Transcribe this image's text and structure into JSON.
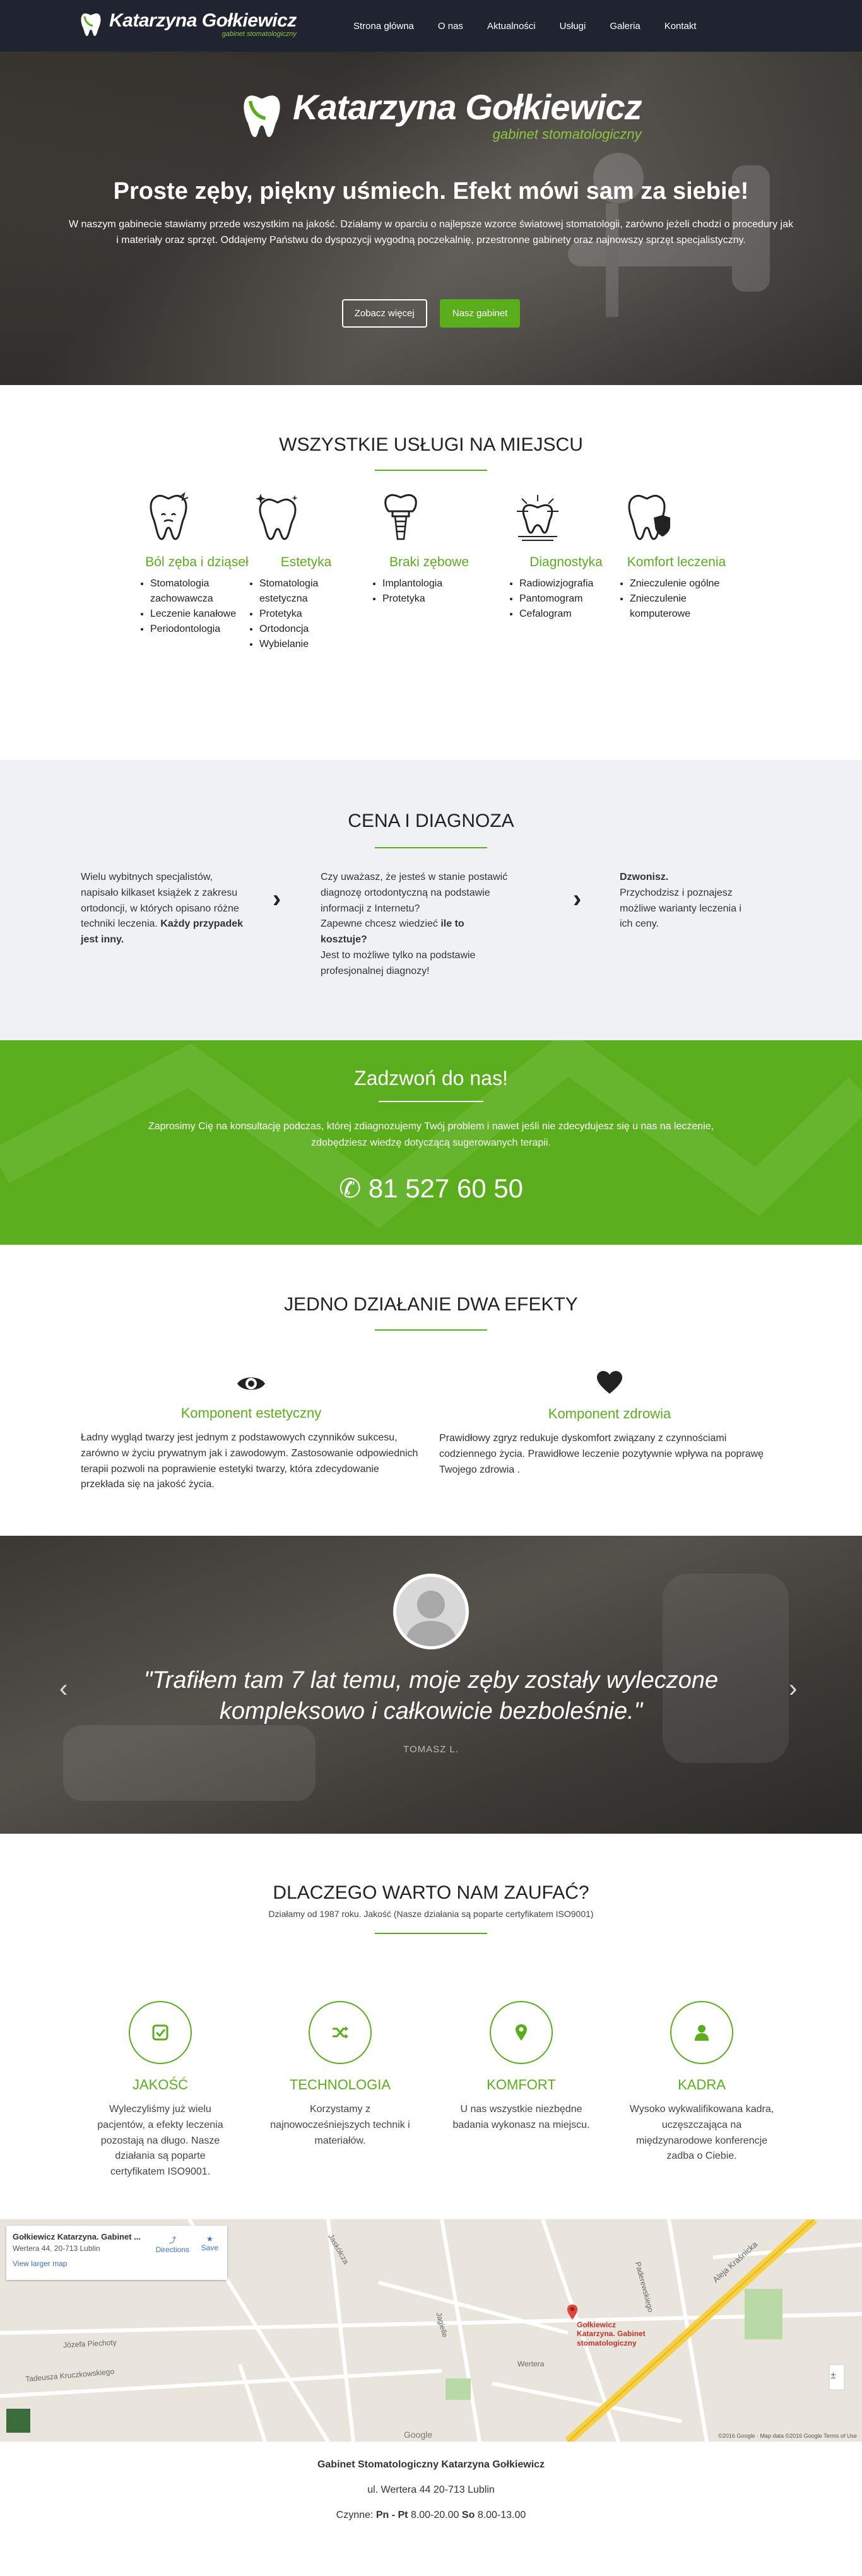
{
  "nav": {
    "logo_first": "Katarzyna",
    "logo_last": "Gołkiewicz",
    "logo_sub": "gabinet stomatologiczny",
    "items": [
      "Strona główna",
      "O nas",
      "Aktualności",
      "Usługi",
      "Galeria",
      "Kontakt"
    ]
  },
  "hero": {
    "logo_first": "Katarzyna",
    "logo_last": "Gołkiewicz",
    "logo_sub": "gabinet stomatologiczny",
    "title": "Proste zęby, piękny uśmiech. Efekt mówi sam za siebie!",
    "text": "W naszym gabinecie stawiamy przede wszystkim na jakość. Działamy w oparciu o najlepsze wzorce światowej stomatologii, zarówno jeżeli chodzi o procedury jak i materiały oraz sprzęt. Oddajemy Państwu do dyspozycji wygodną poczekalnię, przestronne gabinety oraz najnowszy sprzęt specjalistyczny.",
    "btn_more": "Zobacz więcej",
    "btn_office": "Nasz gabinet"
  },
  "services": {
    "title": "WSZYSTKIE USŁUGI NA MIEJSCU",
    "items": [
      {
        "icon": "tooth-pain-icon",
        "title": "Ból zęba i dziąseł",
        "list": [
          "Stomatologia zachowawcza",
          "Leczenie kanałowe",
          "Periodontologia"
        ]
      },
      {
        "icon": "tooth-sparkle-icon",
        "title": "Estetyka",
        "list": [
          "Stomatologia estetyczna",
          "Protetyka",
          "Ortodoncja",
          "Wybielanie"
        ]
      },
      {
        "icon": "tooth-implant-icon",
        "title": "Braki zębowe",
        "list": [
          "Implantologia",
          "Protetyka"
        ]
      },
      {
        "icon": "tooth-xray-icon",
        "title": "Diagnostyka",
        "list": [
          "Radiowizjografia",
          "Pantomogram",
          "Cefalogram"
        ]
      },
      {
        "icon": "tooth-shield-icon",
        "title": "Komfort leczenia",
        "list": [
          "Znieczulenie ogólne",
          "Znieczulenie komputerowe"
        ]
      }
    ]
  },
  "pricing": {
    "title": "CENA I DIAGNOZA",
    "col1": "Wielu wybitnych specjalistów, napisało kilkaset książek z zakresu ortodoncji, w których opisano różne techniki leczenia.",
    "col1_bold": "Każdy przypadek jest inny.",
    "col2a": "Czy uważasz, że jesteś w stanie postawić diagnozę ortodontyczną na podstawie informacji z Internetu?",
    "col2b": "Zapewne chcesz wiedzieć",
    "col2b_bold": "ile to kosztuje?",
    "col2c": "Jest to możliwe tylko na podstawie profesjonalnej diagnozy!",
    "col3_bold": "Dzwonisz.",
    "col3": "Przychodzisz i poznajesz możliwe warianty leczenia i ich ceny."
  },
  "call": {
    "title": "Zadzwoń do nas!",
    "text": "Zaprosimy Cię na konsultację podczas, której zdiagnozujemy Twój problem i nawet jeśli nie zdecydujesz się u nas na leczenie, zdobędziesz wiedzę dotyczącą sugerowanych terapii.",
    "phone": "81 527 60 50"
  },
  "effects": {
    "title": "JEDNO DZIAŁANIE DWA EFEKTY",
    "left_title": "Komponent estetyczny",
    "left_text": "Ładny wygląd twarzy jest jednym z podstawowych czynników sukcesu, zarówno w życiu prywatnym jak i zawodowym. Zastosowanie odpowiednich terapii pozwoli na poprawienie estetyki twarzy, która zdecydowanie przekłada się na jakość życia.",
    "right_title": "Komponent zdrowia",
    "right_text": "Prawidłowy zgryz redukuje dyskomfort związany z czynnościami codziennego życia. Prawidłowe leczenie pozytywnie wpływa na poprawę Twojego zdrowia ."
  },
  "testimonial": {
    "quote": "\"Trafiłem tam 7 lat temu, moje zęby zostały wyleczone kompleksowo i całkowicie bezboleśnie.\"",
    "author": "TOMASZ L."
  },
  "why": {
    "title": "DLACZEGO WARTO NAM ZAUFAĆ?",
    "subtitle": "Działamy od 1987 roku. Jakość (Nasze działania są poparte certyfikatem ISO9001)",
    "items": [
      {
        "icon": "check-icon",
        "title": "JAKOŚĆ",
        "text": "Wyleczyliśmy już wielu pacjentów, a efekty leczenia pozostają na długo. Nasze działania są poparte certyfikatem ISO9001."
      },
      {
        "icon": "shuffle-icon",
        "title": "TECHNOLOGIA",
        "text": "Korzystamy z najnowocześniejszych technik i materiałów."
      },
      {
        "icon": "location-icon",
        "title": "KOMFORT",
        "text": "U nas wszystkie niezbędne badania wykonasz na miejscu."
      },
      {
        "icon": "user-icon",
        "title": "KADRA",
        "text": "Wysoko wykwalifikowana kadra, uczęszczająca na międzynarodowe konferencje zadba o Ciebie."
      }
    ]
  },
  "map": {
    "card_title": "Gołkiewicz Katarzyna. Gabinet ...",
    "card_address": "Wertera 44, 20-713 Lublin",
    "card_link": "View larger map",
    "directions": "Directions",
    "save": "Save",
    "pin_label": "Gołkiewicz Katarzyna. Gabinet stomatologiczny",
    "streets": [
      "Jaskółcza",
      "Aleja Kraśnicka",
      "Wertera",
      "Jagielle",
      "Paderewskiego",
      "Tadeusza Kruczkowskiego",
      "Józefa Piechoty"
    ],
    "copyright": "©2016 Google · Map data ©2016 Google   Terms of Use"
  },
  "footer": {
    "name": "Gabinet Stomatologiczny Katarzyna Gołkiewicz",
    "address": "ul. Wertera 44 20-713 Lublin",
    "hours_label": "Czynne:",
    "days1": "Pn - Pt",
    "hours1": "8.00-20.00",
    "days2": "So",
    "hours2": "8.00-13.00"
  }
}
